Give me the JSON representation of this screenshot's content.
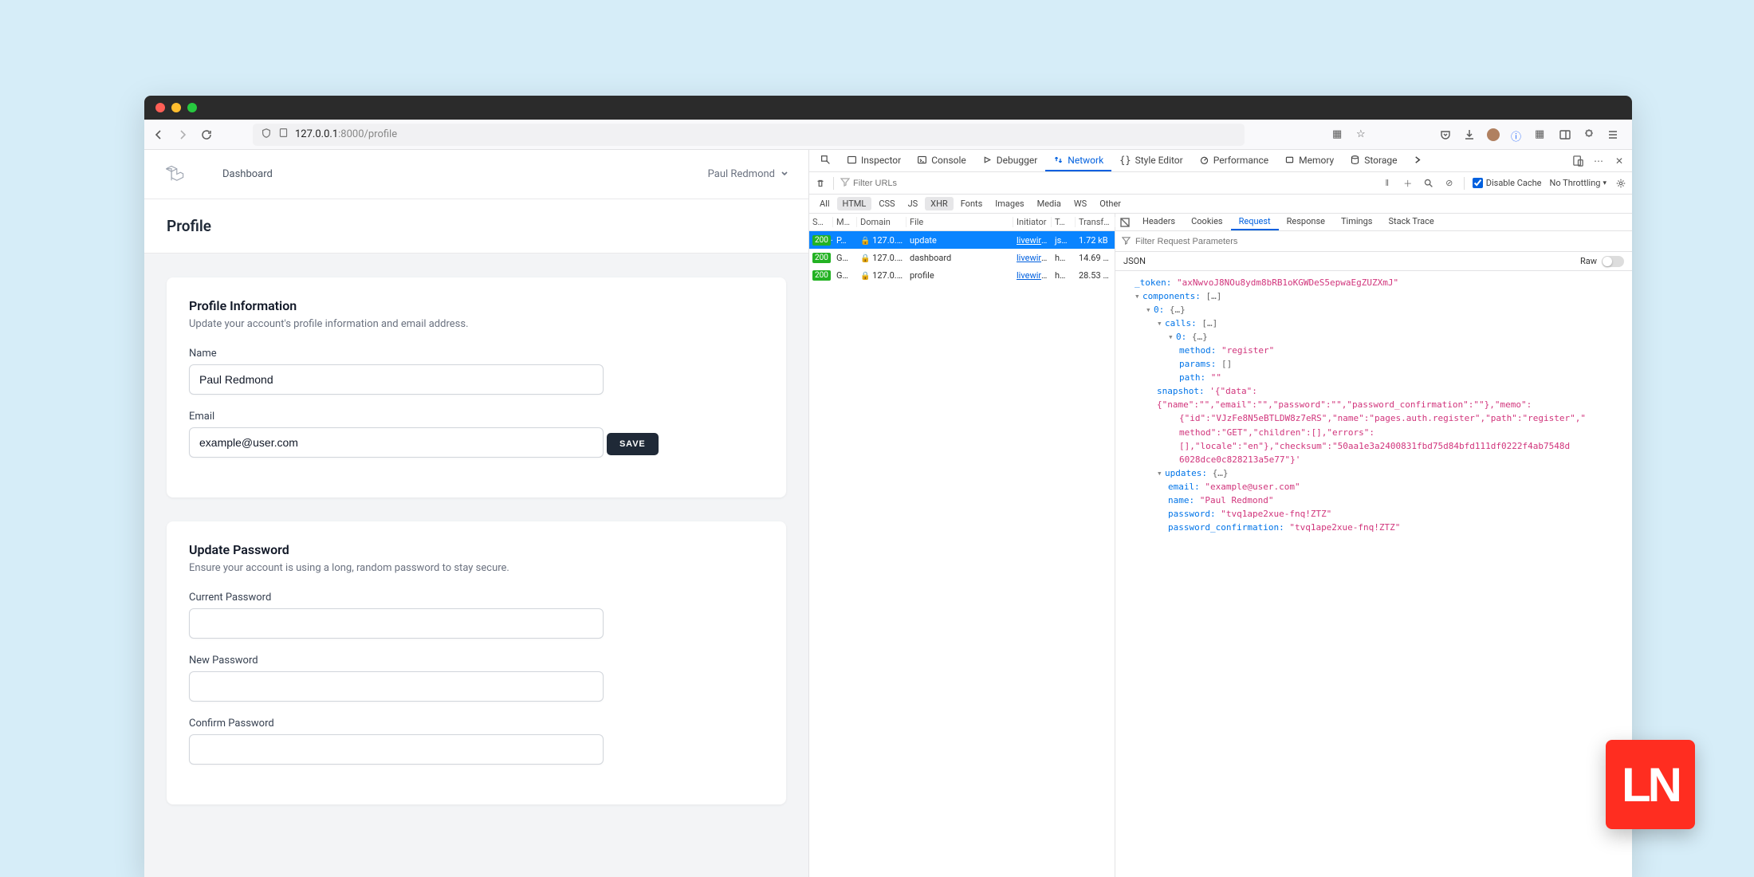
{
  "url": {
    "host": "127.0.0.1",
    "port_path": ":8000/profile"
  },
  "app": {
    "nav": {
      "dashboard": "Dashboard"
    },
    "user": "Paul Redmond",
    "page_title": "Profile",
    "profile_card": {
      "title": "Profile Information",
      "subtitle": "Update your account's profile information and email address.",
      "name_label": "Name",
      "name_value": "Paul Redmond",
      "email_label": "Email",
      "email_value": "example@user.com",
      "save": "SAVE"
    },
    "password_card": {
      "title": "Update Password",
      "subtitle": "Ensure your account is using a long, random password to stay secure.",
      "current_label": "Current Password",
      "new_label": "New Password",
      "confirm_label": "Confirm Password"
    }
  },
  "devtools": {
    "tabs": {
      "inspector": "Inspector",
      "console": "Console",
      "debugger": "Debugger",
      "network": "Network",
      "style": "Style Editor",
      "performance": "Performance",
      "memory": "Memory",
      "storage": "Storage"
    },
    "filter_placeholder": "Filter URLs",
    "disable_cache": "Disable Cache",
    "throttle": "No Throttling",
    "types": {
      "all": "All",
      "html": "HTML",
      "css": "CSS",
      "js": "JS",
      "xhr": "XHR",
      "fonts": "Fonts",
      "images": "Images",
      "media": "Media",
      "ws": "WS",
      "other": "Other"
    },
    "cols": {
      "status": "S…",
      "method": "Me…",
      "domain": "Domain",
      "file": "File",
      "initiator": "Initiator",
      "type": "T…",
      "transf": "Transf…"
    },
    "rows": [
      {
        "status": "200",
        "method": "P…",
        "domain": "127.0.0.…",
        "file": "update",
        "initiator": "livewire…",
        "type": "js…",
        "size": "1.72 kB",
        "selected": true
      },
      {
        "status": "200",
        "method": "G…",
        "domain": "127.0.0.…",
        "file": "dashboard",
        "initiator": "livewire…",
        "type": "h…",
        "size": "14.69 kB",
        "selected": false
      },
      {
        "status": "200",
        "method": "G…",
        "domain": "127.0.0.…",
        "file": "profile",
        "initiator": "livewire…",
        "type": "h…",
        "size": "28.53 …",
        "selected": false
      }
    ],
    "detail_tabs": {
      "headers": "Headers",
      "cookies": "Cookies",
      "request": "Request",
      "response": "Response",
      "timings": "Timings",
      "stack": "Stack Trace"
    },
    "detail_filter_placeholder": "Filter Request Parameters",
    "json_label": "JSON",
    "raw_label": "Raw",
    "json": {
      "token_key": "_token:",
      "token_val": "\"axNwvoJ8NOu8ydm8bRB1oKGWDeS5epwaEgZUZXmJ\"",
      "components": "components:",
      "zero": "0:",
      "calls": "calls:",
      "method_k": "method:",
      "method_v": "\"register\"",
      "params_k": "params:",
      "params_v": "[]",
      "path_k": "path:",
      "path_v": "\"\"",
      "snapshot_k": "snapshot:",
      "snapshot_v1": "'{\"data\":{\"name\":\"\",\"email\":\"\",\"password\":\"\",\"password_confirmation\":\"\"},\"memo\":",
      "snapshot_v2": "{\"id\":\"VJzFe8N5eBTLDW8z7eRS\",\"name\":\"pages.auth.register\",\"path\":\"register\",\"",
      "snapshot_v3": "method\":\"GET\",\"children\":[],\"errors\":",
      "snapshot_v4": "[],\"locale\":\"en\"},\"checksum\":\"50aa1e3a2400831fbd75d84bfd111df0222f4ab7548d",
      "snapshot_v5": "6028dce0c828213a5e77\"}'",
      "updates_k": "updates:",
      "email_k": "email:",
      "email_v": "\"example@user.com\"",
      "name_k": "name:",
      "name_v": "\"Paul Redmond\"",
      "password_k": "password:",
      "password_v": "\"tvq1ape2xue-fnq!ZTZ\"",
      "passconf_k": "password_confirmation:",
      "passconf_v": "\"tvq1ape2xue-fnq!ZTZ\""
    }
  }
}
